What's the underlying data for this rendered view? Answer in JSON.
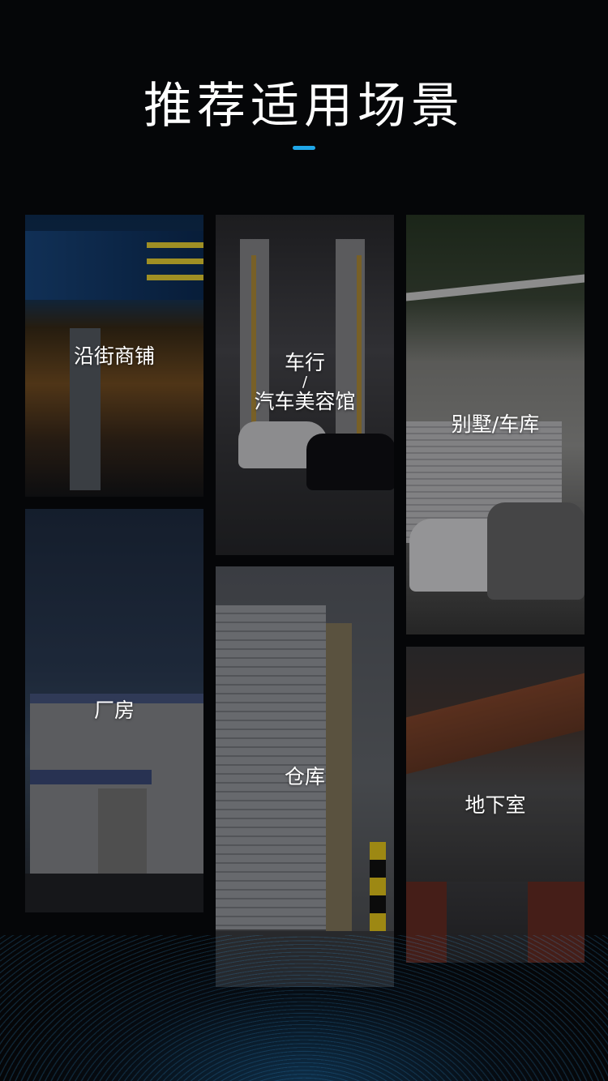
{
  "header": {
    "title": "推荐适用场景",
    "accent_color": "#1fa6e8"
  },
  "tiles": [
    {
      "label": "沿街商铺"
    },
    {
      "label_line1": "车行",
      "separator": "/",
      "label_line2": "汽车美容馆"
    },
    {
      "label": "别墅/车库"
    },
    {
      "label": "厂房"
    },
    {
      "label": "仓库"
    },
    {
      "label": "地下室"
    }
  ]
}
